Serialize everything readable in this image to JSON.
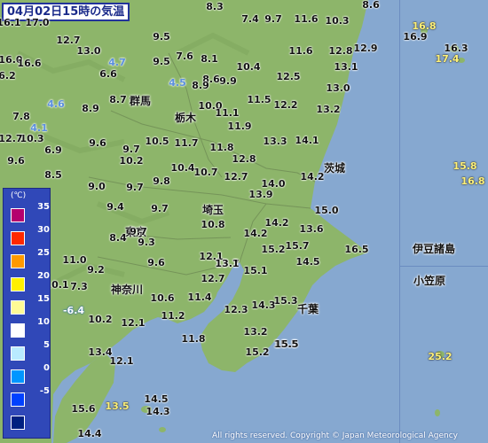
{
  "title": "04月02日15時の気温",
  "copyright": "All rights reserved. Copyright © Japan Meteorological Agency",
  "legend": {
    "unit": "(℃)",
    "items": [
      {
        "label": "35",
        "color": "#b4006e"
      },
      {
        "label": "30",
        "color": "#ff2800"
      },
      {
        "label": "25",
        "color": "#ff9900"
      },
      {
        "label": "20",
        "color": "#fff000"
      },
      {
        "label": "15",
        "color": "#fffa96"
      },
      {
        "label": "10",
        "color": "#ffffff"
      },
      {
        "label": "5",
        "color": "#b9ebff"
      },
      {
        "label": "0",
        "color": "#0096ff"
      },
      {
        "label": "-5",
        "color": "#0041ff"
      },
      {
        "label": "",
        "color": "#002080"
      }
    ]
  },
  "places": [
    {
      "id": "gunma",
      "label": "群馬"
    },
    {
      "id": "tochigi",
      "label": "栃木"
    },
    {
      "id": "ibaraki",
      "label": "茨城"
    },
    {
      "id": "saitama",
      "label": "埼玉"
    },
    {
      "id": "tokyo",
      "label": "東京"
    },
    {
      "id": "kanagawa",
      "label": "神奈川"
    },
    {
      "id": "chiba",
      "label": "千葉"
    },
    {
      "id": "izu",
      "label": "伊豆諸島"
    },
    {
      "id": "ogasawara",
      "label": "小笠原"
    }
  ],
  "readings": [
    "16.1",
    "17.0",
    "12.7",
    "13.0",
    "9.5",
    "8.3",
    "7.4",
    "9.7",
    "11.6",
    "10.3",
    "8.6",
    "16.0",
    "16.6",
    "6.6",
    "4.7",
    "7.6",
    "8.1",
    "9.5",
    "11.6",
    "12.8",
    "12.9",
    "6.2",
    "8.6",
    "10.4",
    "13.1",
    "4.5",
    "8.9",
    "9.9",
    "12.5",
    "13.0",
    "8.9",
    "8.7",
    "10.0",
    "11.5",
    "12.2",
    "4.6",
    "7.8",
    "11.1",
    "13.2",
    "4.1",
    "10.3",
    "11.9",
    "12.7",
    "9.6",
    "9.7",
    "10.5",
    "11.7",
    "11.8",
    "13.3",
    "14.1",
    "9.6",
    "6.9",
    "10.2",
    "12.8",
    "8.5",
    "10.4",
    "10.7",
    "12.7",
    "14.0",
    "14.2",
    "9.0",
    "9.7",
    "9.8",
    "13.9",
    "15.0",
    "9.4",
    "9.7",
    "10.8",
    "14.2",
    "13.6",
    "8.4",
    "9.3",
    "9.7",
    "14.2",
    "15.2",
    "15.7",
    "16.5",
    "11.0",
    "9.6",
    "12.1",
    "13.7",
    "14.5",
    "9.2",
    "13.1",
    "15.1",
    "10.1",
    "7.3",
    "12.7",
    "-6.4",
    "10.6",
    "11.4",
    "15.3",
    "10.2",
    "11.2",
    "12.3",
    "14.3",
    "12.1",
    "13.2",
    "11.8",
    "13.4",
    "15.5",
    "12.1",
    "15.2",
    "15.5",
    "14.5",
    "14.3",
    "15.6",
    "13.5",
    "14.4",
    "16.8",
    "16.9",
    "16.3",
    "17.4",
    "15.8",
    "16.8",
    "25.2"
  ]
}
